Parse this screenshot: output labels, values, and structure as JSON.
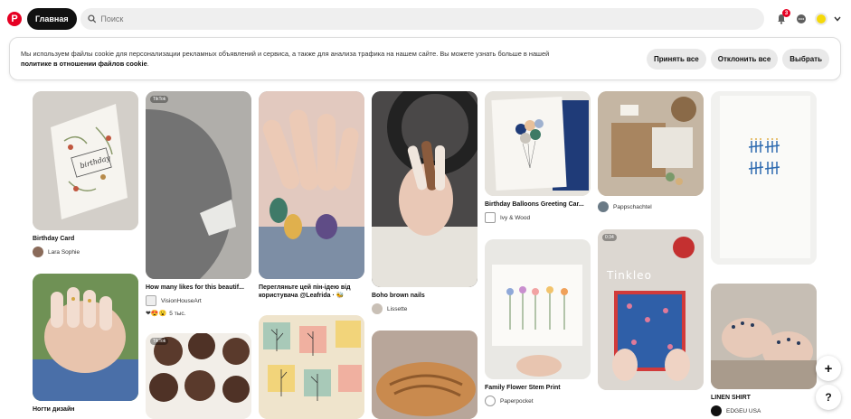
{
  "header": {
    "logo": "P",
    "home_label": "Главная",
    "search_placeholder": "Поиск",
    "notifications_count": "3"
  },
  "cookie": {
    "text": "Мы используем файлы cookie для персонализации рекламных объявлений и сервиса, а также для анализа трафика на нашем сайте. Вы можете узнать больше в нашей",
    "link": "политике в отношении файлов cookie",
    "accept": "Принять все",
    "decline": "Отклонить все",
    "choose": "Выбрать"
  },
  "pins": [
    {
      "title": "Birthday Card",
      "author": "Lara Sophie"
    },
    {
      "title": "How many likes for this beautif...",
      "author": "VisionHouseArt",
      "reactions": "5 тыс.",
      "tag": "TikTok"
    },
    {
      "title": "Перегляньте цей пін-ідею від",
      "title2": "користувача @Leafrida · 🐝"
    },
    {
      "title": "Boho brown nails",
      "author": "Lissette"
    },
    {
      "title": "Birthday Balloons Greeting Car...",
      "author": "Ivy & Wood"
    },
    {
      "author": "Pappschachtel"
    },
    {
      "title": "Family Flower Stem Print",
      "author": "Paperpocket"
    },
    {
      "title": "Ногти дизайн"
    },
    {
      "tag": "TikTok"
    },
    {
      "tag": "0:34",
      "overlay": "Tinkleo"
    },
    {
      "title": "LINEN SHIRT",
      "author": "EDGEU USA"
    }
  ],
  "fab": {
    "plus": "+",
    "help": "?"
  }
}
